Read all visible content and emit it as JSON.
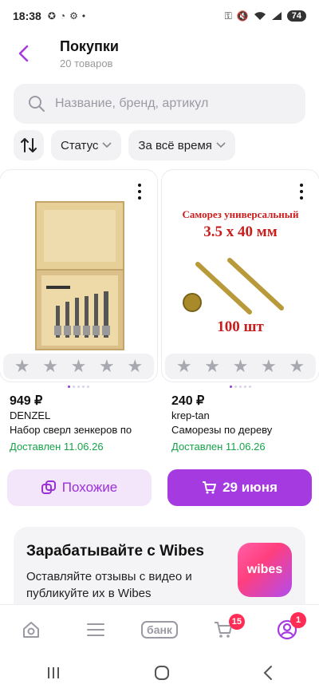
{
  "status_bar": {
    "time": "18:38",
    "battery": "74"
  },
  "header": {
    "title": "Покупки",
    "subtitle": "20 товаров"
  },
  "search": {
    "placeholder": "Название, бренд, артикул"
  },
  "filters": {
    "status_label": "Статус",
    "period_label": "За всё время"
  },
  "products": [
    {
      "price": "949 ₽",
      "brand": "DENZEL",
      "name": "Набор сверл зенкеров по",
      "delivered": "Доставлен 11.06.26",
      "image_icon": "drill-bit-set-box-image"
    },
    {
      "price": "240 ₽",
      "brand": "krep-tan",
      "name": "Саморезы по дереву",
      "delivered": "Доставлен 11.06.26",
      "image_text": {
        "line1": "Саморез универсальный",
        "line2": "3.5 х 40 мм",
        "line3": "100 шт"
      }
    }
  ],
  "actions": {
    "similar_label": "Похожие",
    "date_label": "29 июня"
  },
  "promo": {
    "title": "Зарабатывайте с Wibes",
    "text": "Оставляйте отзывы с видео и публикуйте их в Wibes",
    "logo_text": "wibes"
  },
  "bottom_nav": {
    "bank_label": "банк",
    "cart_badge": "15",
    "profile_badge": "1"
  },
  "colors": {
    "accent": "#a53ae0",
    "accent_light": "#f3e6fb",
    "delivered": "#16a34a",
    "badge": "#ff2d55"
  }
}
